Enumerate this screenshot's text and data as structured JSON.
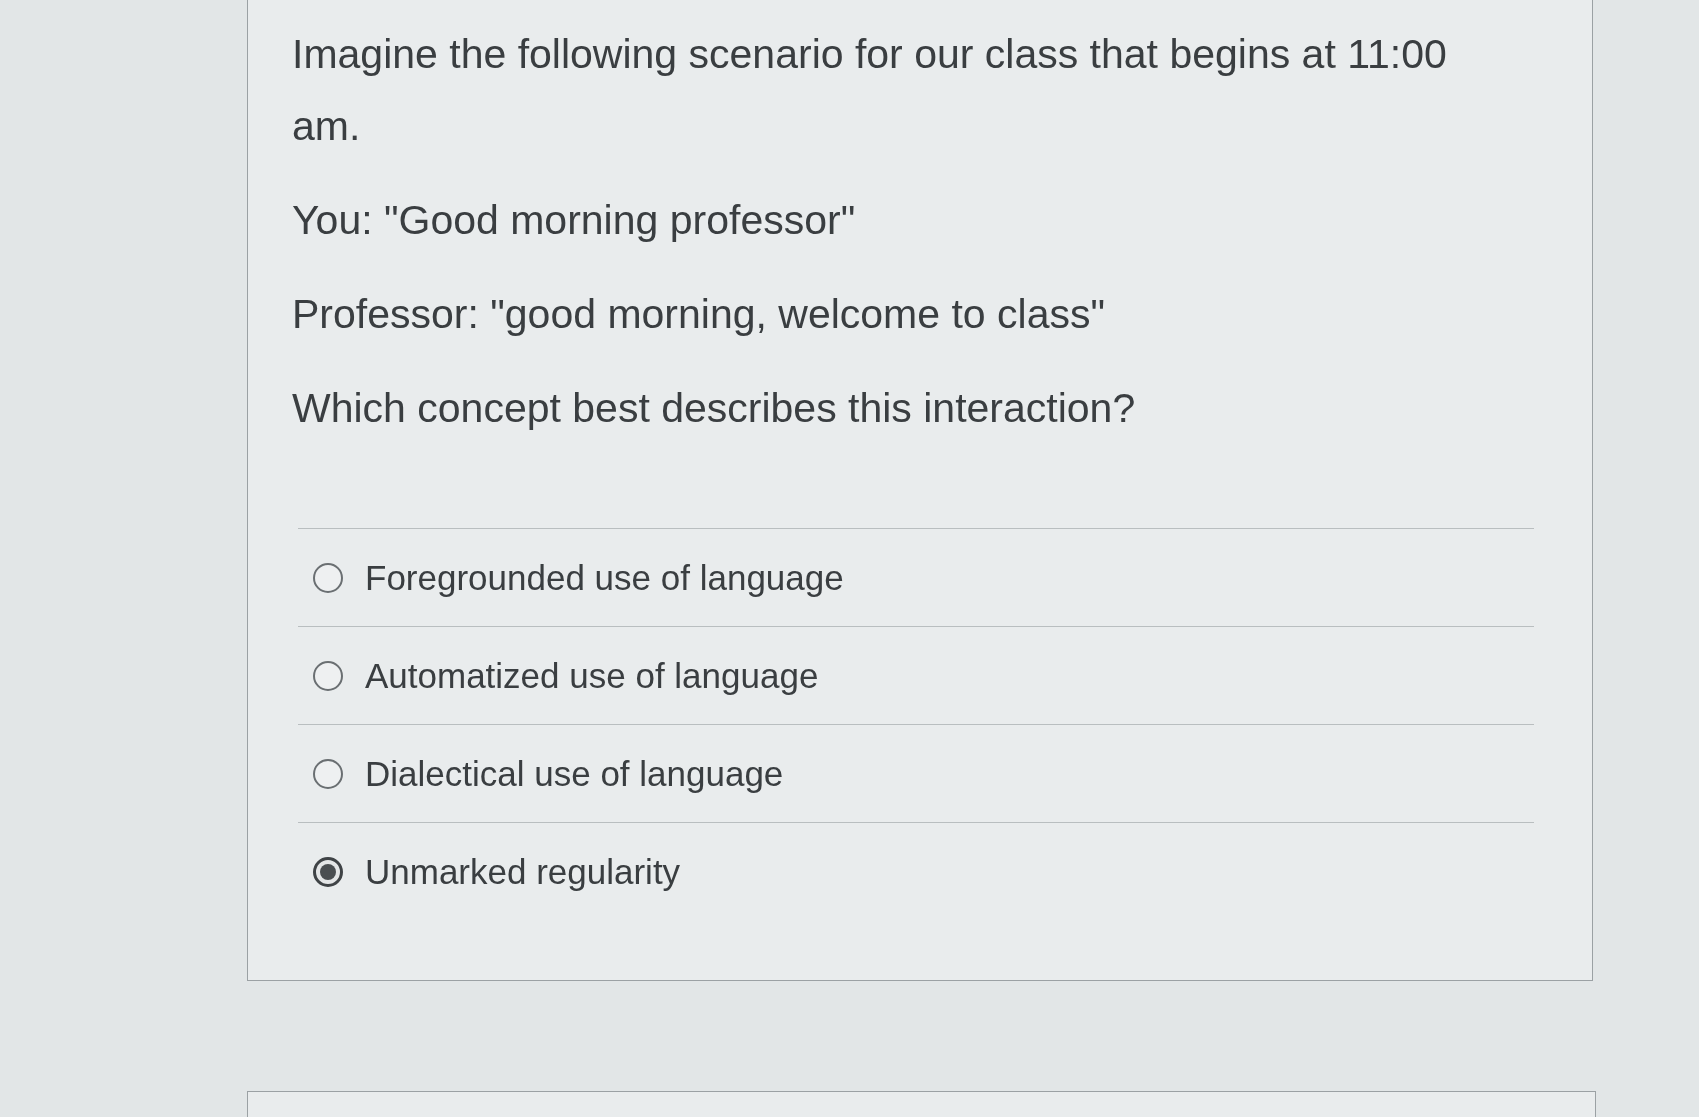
{
  "question": {
    "paragraphs": [
      "Imagine the following scenario for our class that begins at 11:00 am.",
      "You: \"Good morning professor\"",
      "Professor: \"good morning, welcome to class\"",
      "Which concept best describes this interaction?"
    ]
  },
  "options": [
    {
      "label": "Foregrounded use of language",
      "selected": false
    },
    {
      "label": "Automatized use of language",
      "selected": false
    },
    {
      "label": "Dialectical use of language",
      "selected": false
    },
    {
      "label": "Unmarked regularity",
      "selected": true
    }
  ]
}
